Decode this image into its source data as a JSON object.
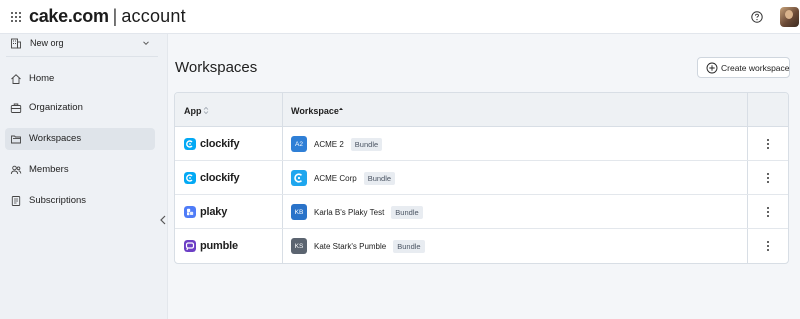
{
  "header": {
    "brand_bold": "cake.com",
    "brand_separator": "|",
    "brand_light": "account",
    "icons": [
      "apps-grid-icon",
      "help-icon",
      "user-avatar"
    ]
  },
  "sidebar": {
    "org": {
      "label": "New org",
      "icon": "building-icon"
    },
    "items": [
      {
        "label": "Home",
        "icon": "home-icon",
        "active": false
      },
      {
        "label": "Organization",
        "icon": "briefcase-icon",
        "active": false
      },
      {
        "label": "Workspaces",
        "icon": "folders-icon",
        "active": true
      },
      {
        "label": "Members",
        "icon": "people-icon",
        "active": false
      },
      {
        "label": "Subscriptions",
        "icon": "document-icon",
        "active": false
      }
    ],
    "collapse_icon": "chevron-left-icon"
  },
  "main": {
    "title": "Workspaces",
    "create_button": {
      "label": "Create workspace",
      "icon": "plus-circle-icon"
    },
    "table": {
      "columns": [
        {
          "label": "App",
          "sort": "none"
        },
        {
          "label": "Workspace",
          "sort": "ascending"
        }
      ],
      "rows": [
        {
          "app": "clockify",
          "workspace_initials": "A2",
          "workspace_name": "ACME 2",
          "tag": "Bundle"
        },
        {
          "app": "clockify",
          "workspace_initials": "",
          "workspace_name": "ACME Corp",
          "tag": "Bundle"
        },
        {
          "app": "plaky",
          "workspace_initials": "KB",
          "workspace_name": "Karla B's Plaky Test",
          "tag": "Bundle"
        },
        {
          "app": "pumble",
          "workspace_initials": "KS",
          "workspace_name": "Kate Stark's Pumble",
          "tag": "Bundle"
        }
      ]
    }
  },
  "colors": {
    "clockify": "#03a9f4",
    "plaky": "#4f7cf7",
    "pumble": "#6c3fc5",
    "badge_a2": "#2f7fd6",
    "badge_kb": "#2a73c9",
    "badge_ks": "#5b6470",
    "active_nav": "#dfe4ea"
  }
}
